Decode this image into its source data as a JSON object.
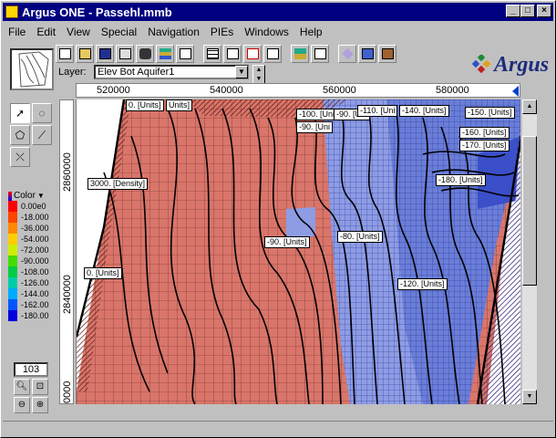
{
  "window": {
    "title": "Argus ONE - Passehl.mmb"
  },
  "titlebar_buttons": {
    "minimize": "_",
    "maximize": "□",
    "close": "×"
  },
  "menu": [
    "File",
    "Edit",
    "View",
    "Special",
    "Navigation",
    "PIEs",
    "Windows",
    "Help"
  ],
  "toolbar": {
    "icons": [
      "new-file-icon",
      "open-file-icon",
      "save-icon",
      "print-icon",
      "binoculars-icon",
      "layers-icon",
      "layers-alt-icon",
      "zoom-fit-icon",
      "grid-icon",
      "text-icon",
      "formula-icon",
      "stack-icon",
      "book-icon",
      "diamond-icon",
      "cards-icon",
      "tool-icon"
    ]
  },
  "layer": {
    "label": "Layer:",
    "selected": "Elev Bot Aquifer1"
  },
  "logo": {
    "text": "Argus"
  },
  "ruler": {
    "x_labels": [
      "520000",
      "540000",
      "560000",
      "580000"
    ],
    "y_labels": [
      "2860000",
      "2840000",
      "0000"
    ]
  },
  "legend": {
    "title": "Color",
    "entries": [
      {
        "label": "0.00e0",
        "color": "#ff0000"
      },
      {
        "label": "-18.000",
        "color": "#ff4400"
      },
      {
        "label": "-36.000",
        "color": "#ff8800"
      },
      {
        "label": "-54.000",
        "color": "#ffcc00"
      },
      {
        "label": "-72.000",
        "color": "#ccee00"
      },
      {
        "label": "-90.000",
        "color": "#44dd00"
      },
      {
        "label": "-108.00",
        "color": "#00cc44"
      },
      {
        "label": "-126.00",
        "color": "#00ccaa"
      },
      {
        "label": "-144.00",
        "color": "#00aaff"
      },
      {
        "label": "-162.00",
        "color": "#0055ff"
      },
      {
        "label": "-180.00",
        "color": "#0000dd"
      }
    ]
  },
  "zoom": {
    "value": "103"
  },
  "map_labels": [
    "0. [Units]",
    "-100. [Uni",
    "-90. [Uni",
    "-110. [Uni",
    "-140. [Units]",
    "-150. [Units]",
    "-90. [Units]",
    "-160. [Units]",
    "-170. [Units]",
    "-180. [Units]",
    "3000. [Density]",
    "-90. [Units]",
    "-80. [Units]",
    "0. [Units]",
    "-120. [Units]",
    "Units]"
  ],
  "colors": {
    "mesh_red": "#d9756a",
    "mesh_blue": "#7a8fe0",
    "mesh_dark_blue": "#3a4fc8"
  }
}
